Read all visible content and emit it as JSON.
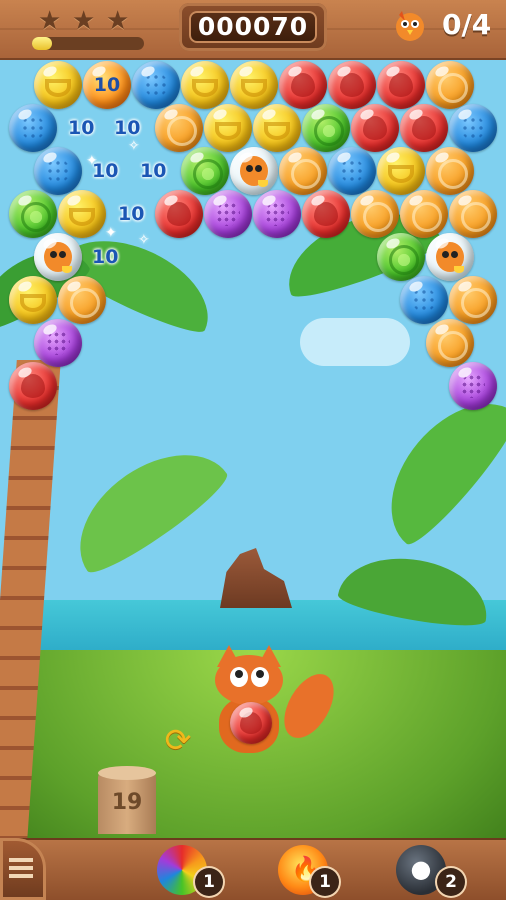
{
  "header": {
    "score": "000070",
    "stars_earned": 0,
    "stars_total": 3,
    "progress_fraction": 0.18,
    "goal": {
      "icon": "bird-icon",
      "count": "0/4"
    }
  },
  "board": {
    "floating_points": [
      "10",
      "10",
      "10",
      "10",
      "10",
      "10",
      "10",
      "10"
    ],
    "special_bubble_label": "10"
  },
  "launcher": {
    "current_bubble": "strawberry",
    "shots_remaining": "19"
  },
  "boosters": [
    {
      "name": "rainbow-bubble",
      "count": "1"
    },
    {
      "name": "fireball",
      "count": "1"
    },
    {
      "name": "bomb",
      "count": "2"
    }
  ],
  "colors": {
    "score_text": "#ffffff",
    "points_text": "#1b56b4",
    "wood": "#a9643a"
  }
}
